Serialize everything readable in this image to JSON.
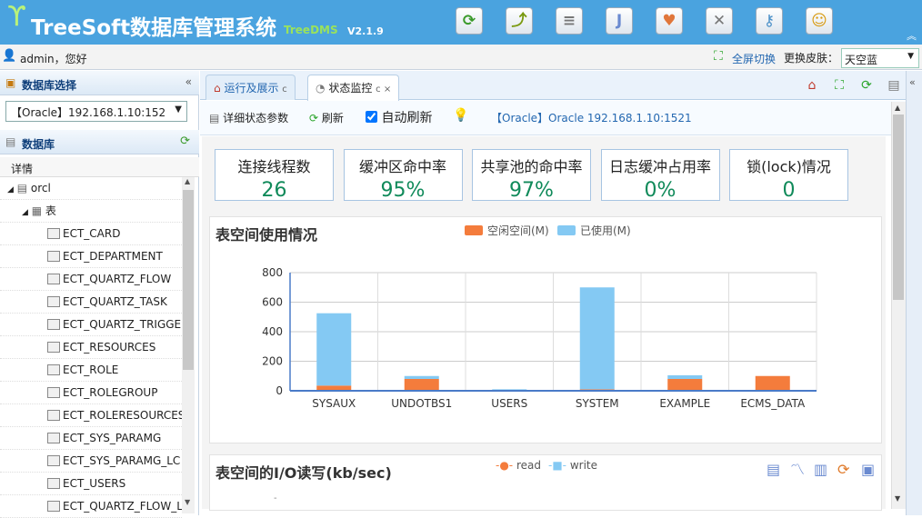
{
  "header": {
    "app_title": "TreeSoft数据库管理系统",
    "app_subtitle": "TreeDMS",
    "version": "V2.1.9",
    "toolbar_icons": [
      {
        "name": "refresh-icon",
        "glyph": "⟳",
        "color": "#3a9a2a"
      },
      {
        "name": "chart-icon",
        "glyph": "⤴",
        "color": "#7a9a10"
      },
      {
        "name": "database-icon",
        "glyph": "≡",
        "color": "#777"
      },
      {
        "name": "java-icon",
        "glyph": "J",
        "color": "#6a8ad0"
      },
      {
        "name": "heart-icon",
        "glyph": "♥",
        "color": "#e0763a"
      },
      {
        "name": "tools-icon",
        "glyph": "✕",
        "color": "#777"
      },
      {
        "name": "key-icon",
        "glyph": "⚷",
        "color": "#4a90c8"
      },
      {
        "name": "user-icon",
        "glyph": "☺",
        "color": "#d89a10"
      }
    ]
  },
  "userbar": {
    "welcome": "admin，您好",
    "fullscreen_label": "全屏切换",
    "skin_label": "更换皮肤：",
    "skin_value": "天空蓝"
  },
  "sidebar": {
    "db_select_title": "数据库选择",
    "db_selected": "【Oracle】192.168.1.10:152",
    "db_panel_title": "数据库",
    "tree_column": "详情",
    "tree": {
      "root": "orcl",
      "folder": "表",
      "tables": [
        "ECT_CARD",
        "ECT_DEPARTMENT",
        "ECT_QUARTZ_FLOW",
        "ECT_QUARTZ_TASK",
        "ECT_QUARTZ_TRIGGE",
        "ECT_RESOURCES",
        "ECT_ROLE",
        "ECT_ROLEGROUP",
        "ECT_ROLERESOURCES",
        "ECT_SYS_PARAMG",
        "ECT_SYS_PARAMG_LC",
        "ECT_USERS",
        "ECT_QUARTZ_FLOW_L"
      ]
    }
  },
  "tabs": [
    {
      "label": "运行及展示",
      "close": "c"
    },
    {
      "label": "状态监控",
      "close": "c ×"
    }
  ],
  "toolbar": {
    "detail_label": "详细状态参数",
    "refresh_label": "刷新",
    "auto_refresh_label": "自动刷新",
    "auto_refresh_checked": true,
    "connection_label": "【Oracle】Oracle 192.168.1.10:1521"
  },
  "stats": [
    {
      "label": "连接线程数",
      "value": "26"
    },
    {
      "label": "缓冲区命中率",
      "value": "95%"
    },
    {
      "label": "共享池的命中率",
      "value": "97%"
    },
    {
      "label": "日志缓冲占用率",
      "value": "0%"
    },
    {
      "label": "锁(lock)情况",
      "value": "0"
    }
  ],
  "tablespace_panel": {
    "title": "表空间使用情况"
  },
  "chart_data": [
    {
      "type": "bar",
      "stacked": true,
      "title": "表空间使用情况",
      "categories": [
        "SYSAUX",
        "UNDOTBS1",
        "USERS",
        "SYSTEM",
        "EXAMPLE",
        "ECMS_DATA"
      ],
      "series": [
        {
          "name": "空闲空间(M)",
          "color": "#f47c3c",
          "values": [
            35,
            80,
            5,
            10,
            80,
            100
          ]
        },
        {
          "name": "已使用(M)",
          "color": "#84c9f3",
          "values": [
            490,
            20,
            5,
            690,
            25,
            0
          ]
        }
      ],
      "ylim": [
        0,
        800
      ],
      "yticks": [
        0,
        200,
        400,
        600,
        800
      ],
      "grid": true,
      "legend": "top"
    },
    {
      "type": "line",
      "title": "表空间的I/O读写(kb/sec)",
      "series": [
        {
          "name": "read",
          "color": "#f47c3c"
        },
        {
          "name": "write",
          "color": "#84c9f3"
        }
      ],
      "legend": "top",
      "tools": [
        "data-view-icon",
        "line-chart-icon",
        "bar-chart-icon",
        "restore-icon",
        "save-image-icon"
      ]
    }
  ]
}
